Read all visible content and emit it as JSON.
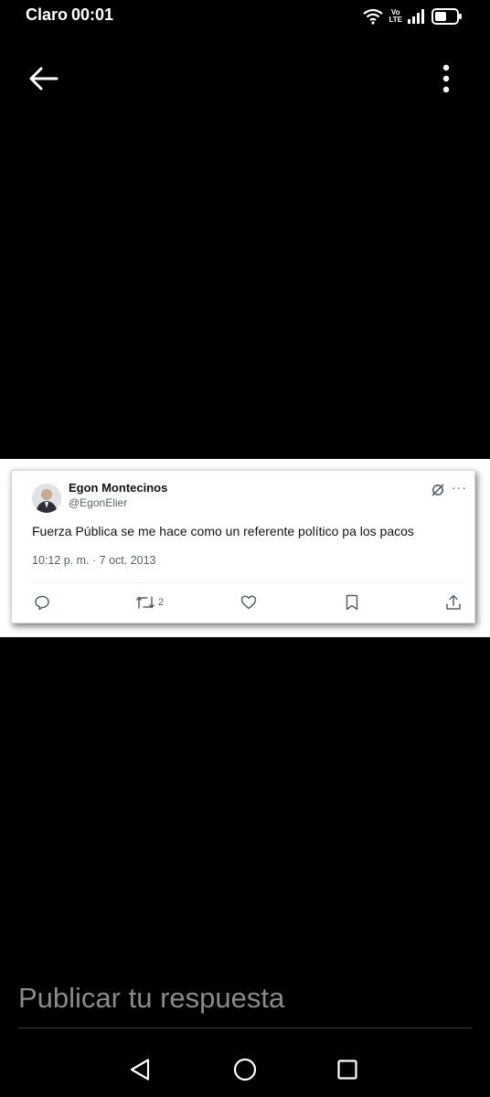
{
  "status_bar": {
    "carrier": "Claro",
    "time": "00:01",
    "volte_top": "Vo",
    "volte_bottom": "LTE"
  },
  "top_bar": {
    "back_icon": "arrow-left-icon",
    "more_icon": "more-vertical-icon"
  },
  "tweet": {
    "display_name": "Egon Montecinos",
    "handle": "@EgonElier",
    "text": "Fuerza Pública se me hace como un referente político pa los pacos",
    "timestamp": "10:12 p. m. · 7 oct. 2013",
    "retweet_count": "2",
    "more": "···",
    "actions": [
      "reply-icon",
      "retweet-icon",
      "like-icon",
      "bookmark-icon",
      "share-icon"
    ]
  },
  "reply": {
    "placeholder": "Publicar tu respuesta"
  },
  "nav_bar": {
    "buttons": [
      "back-triangle-icon",
      "home-circle-icon",
      "recents-square-icon"
    ]
  },
  "colors": {
    "background": "#000000",
    "tweet_text": "#0f1419",
    "tweet_secondary": "#536471",
    "placeholder": "#8a8a8a"
  }
}
